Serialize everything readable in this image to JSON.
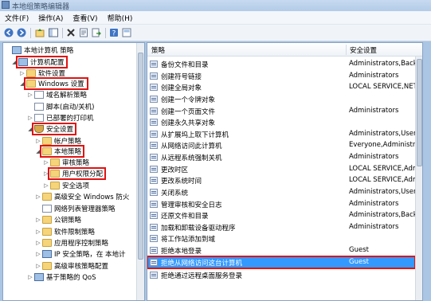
{
  "window": {
    "title": "本地组策略编辑器"
  },
  "menu": [
    "文件(F)",
    "操作(A)",
    "查看(V)",
    "帮助(H)"
  ],
  "toolbar_icons": [
    "back-icon",
    "forward-icon",
    "up-folder-icon",
    "show-hide-tree-icon",
    "delete-icon",
    "properties-icon",
    "export-list-icon",
    "help-icon",
    "view-icon"
  ],
  "tree": [
    {
      "label": "本地计算机 策略",
      "icon": "computer-policy-icon",
      "expander": ""
    },
    {
      "label": "计算机配置",
      "icon": "computer-icon",
      "expander": "◢"
    },
    {
      "label": "软件设置",
      "icon": "folder-icon",
      "expander": "▷"
    },
    {
      "label": "Windows 设置",
      "icon": "folder-icon",
      "expander": "◢"
    },
    {
      "label": "域名解析策略",
      "icon": "document-icon",
      "expander": "▷"
    },
    {
      "label": "脚本(启动/关机)",
      "icon": "document-icon",
      "expander": ""
    },
    {
      "label": "已部署的打印机",
      "icon": "printer-icon",
      "expander": "▷"
    },
    {
      "label": "安全设置",
      "icon": "shield-icon",
      "expander": "◢"
    },
    {
      "label": "帐户策略",
      "icon": "folder-icon",
      "expander": "▷"
    },
    {
      "label": "本地策略",
      "icon": "folder-icon",
      "expander": "◢"
    },
    {
      "label": "审核策略",
      "icon": "folder-icon",
      "expander": "▷"
    },
    {
      "label": "用户权限分配",
      "icon": "folder-icon",
      "expander": "▷"
    },
    {
      "label": "安全选项",
      "icon": "folder-icon",
      "expander": "▷"
    },
    {
      "label": "高级安全 Windows 防火",
      "icon": "firewall-icon",
      "expander": "▷"
    },
    {
      "label": "网络列表管理器策略",
      "icon": "document-icon",
      "expander": ""
    },
    {
      "label": "公钥策略",
      "icon": "folder-icon",
      "expander": "▷"
    },
    {
      "label": "软件限制策略",
      "icon": "folder-icon",
      "expander": "▷"
    },
    {
      "label": "应用程序控制策略",
      "icon": "folder-icon",
      "expander": "▷"
    },
    {
      "label": "IP 安全策略，在 本地计",
      "icon": "ip-security-icon",
      "expander": "▷"
    },
    {
      "label": "高级审核策略配置",
      "icon": "folder-icon",
      "expander": "▷"
    },
    {
      "label": "基于策略的 QoS",
      "icon": "qos-icon",
      "expander": "▷"
    }
  ],
  "list": {
    "columns": [
      "策略",
      "安全设置"
    ],
    "rows": [
      {
        "policy": "备份文件和目录",
        "setting": "Administrators,Backu"
      },
      {
        "policy": "创建符号链接",
        "setting": "Administrators"
      },
      {
        "policy": "创建全局对象",
        "setting": "LOCAL SERVICE,NET"
      },
      {
        "policy": "创建一个令牌对象",
        "setting": ""
      },
      {
        "policy": "创建一个页面文件",
        "setting": "Administrators"
      },
      {
        "policy": "创建永久共享对象",
        "setting": ""
      },
      {
        "policy": "从扩展坞上取下计算机",
        "setting": "Administrators,Users"
      },
      {
        "policy": "从网络访问此计算机",
        "setting": "Everyone,Administrat"
      },
      {
        "policy": "从远程系统强制关机",
        "setting": "Administrators"
      },
      {
        "policy": "更改时区",
        "setting": "LOCAL SERVICE,Adm"
      },
      {
        "policy": "更改系统时间",
        "setting": "LOCAL SERVICE,Adm"
      },
      {
        "policy": "关闭系统",
        "setting": "Administrators,Users"
      },
      {
        "policy": "管理审核和安全日志",
        "setting": "Administrators"
      },
      {
        "policy": "还原文件和目录",
        "setting": "Administrators,Backu"
      },
      {
        "policy": "加载和卸载设备驱动程序",
        "setting": "Administrators"
      },
      {
        "policy": "将工作站添加到域",
        "setting": ""
      },
      {
        "policy": "拒绝本地登录",
        "setting": "Guest"
      },
      {
        "policy": "拒绝从网络访问这台计算机",
        "setting": "Guest"
      },
      {
        "policy": "拒绝通过远程桌面服务登录",
        "setting": ""
      }
    ],
    "selected_index": 17
  },
  "colors": {
    "highlight_box": "#e01313",
    "selection": "#3399ff"
  }
}
